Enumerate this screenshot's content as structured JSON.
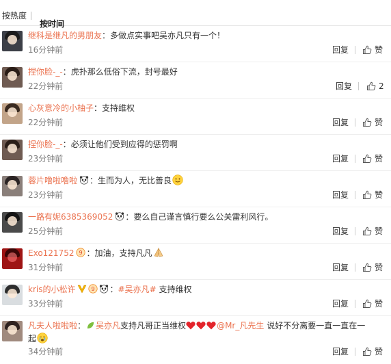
{
  "sort": {
    "hot_label": "按热度",
    "time_label": "按时间"
  },
  "colors": {
    "username": "#eb7350",
    "muted": "#808080",
    "divider": "#eeeeee"
  },
  "comments": [
    {
      "user": "继科是继凡的男朋友",
      "text": "多做点实事吧吴亦凡只有一个！",
      "time": "16分钟前",
      "reply": "回复",
      "like": "赞",
      "avatar": {
        "bg": "#3c3f47",
        "hair": "#1b1b1b"
      }
    },
    {
      "user": "捏你脸-_-",
      "text": "虎扑那么低俗下流，封号最好",
      "time": "22分钟前",
      "reply": "回复",
      "like": "2",
      "avatar": {
        "bg": "#6f5b52",
        "hair": "#2a1d17"
      }
    },
    {
      "user": "心灰意冷的小柚子",
      "text": "支持维权",
      "time": "22分钟前",
      "reply": "回复",
      "like": "赞",
      "avatar": {
        "bg": "#c2a489",
        "hair": "#3a2a20"
      }
    },
    {
      "user": "捏你脸-_-",
      "text": "必须让他们受到应得的惩罚啊",
      "time": "23分钟前",
      "reply": "回复",
      "like": "赞",
      "avatar": {
        "bg": "#6f5b52",
        "hair": "#2a1d17"
      }
    },
    {
      "user": "蓉片噜啦噜啦",
      "text": "生而为人，无比善良",
      "time": "23分钟前",
      "reply": "回复",
      "like": "赞",
      "avatar": {
        "bg": "#8a7f7a",
        "hair": "#2b2424"
      }
    },
    {
      "user": "一路有妮6385369052",
      "text": "要么自己谨言慎行要么公关雷利风行。",
      "time": "25分钟前",
      "reply": "回复",
      "like": "赞",
      "avatar": {
        "bg": "#4a4a4a",
        "hair": "#141414"
      }
    },
    {
      "user": "Exo121752",
      "text": "加油，支持凡凡",
      "time": "31分钟前",
      "reply": "回复",
      "like": "赞",
      "avatar": {
        "bg": "#9e1414",
        "hair": "#3a0606"
      }
    },
    {
      "user": "kris的小松许",
      "topic": "#吴亦凡#",
      "text": "支持维权",
      "time": "33分钟前",
      "reply": "回复",
      "like": "赞",
      "avatar": {
        "bg": "#d9dde0",
        "hair": "#2d2d2d"
      }
    },
    {
      "user": "凡夫人啦啦啦",
      "mention1": "吴亦凡",
      "text_a": "支持凡哥正当维权",
      "mention2": "@Mr_凡先生",
      "text_b": "说好不分离要一直一直在一",
      "text_c": "起",
      "time": "34分钟前",
      "reply": "回复",
      "like": "赞",
      "avatar": {
        "bg": "#a08a7e",
        "hair": "#2e2220"
      }
    }
  ]
}
